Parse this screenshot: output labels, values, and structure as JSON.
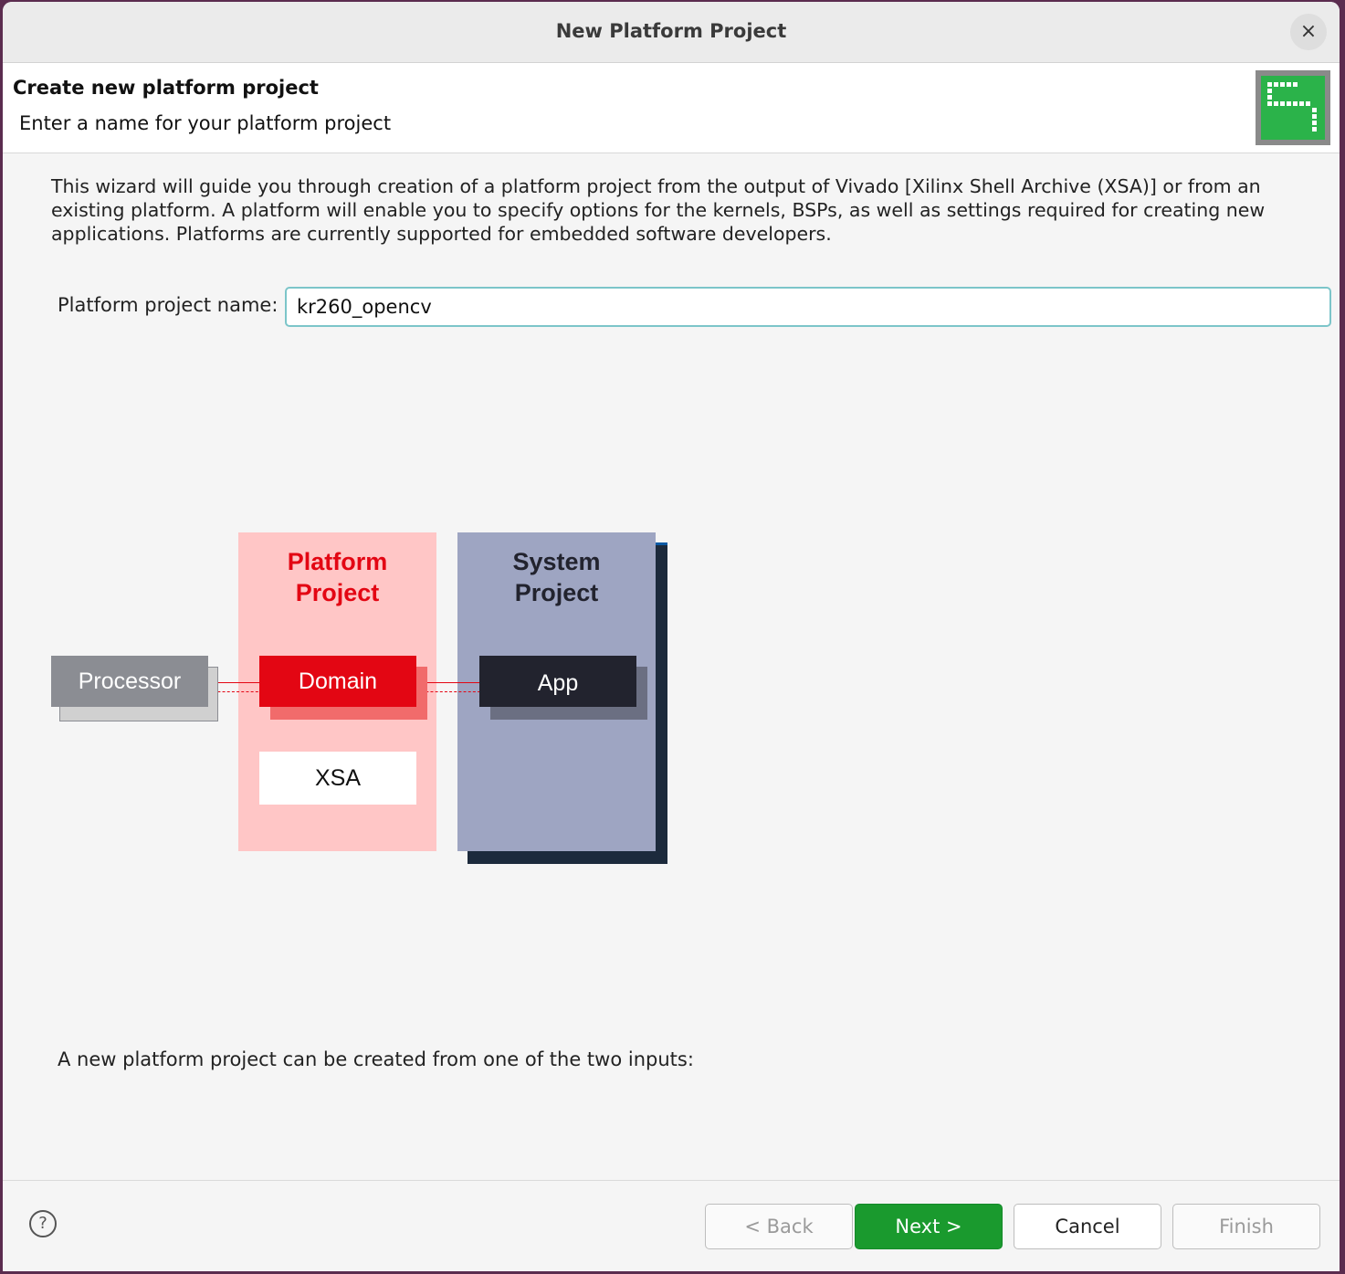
{
  "window": {
    "title": "New Platform Project",
    "close_glyph": "×"
  },
  "header": {
    "title": "Create new platform project",
    "subtitle": "Enter a name for your platform project",
    "logo_icon": "vitis-logo-icon"
  },
  "description": "This wizard will guide you through creation of a platform project from the output of Vivado [Xilinx Shell Archive (XSA)] or from an existing platform. A platform will enable you to specify options for the kernels, BSPs, as well as settings required for creating new applications. Platforms are currently supported for embedded software developers.",
  "form": {
    "name_label": "Platform project name:",
    "name_value": "kr260_opencv"
  },
  "diagram": {
    "processor": "Processor",
    "platform_title_1": "Platform",
    "platform_title_2": "Project",
    "domain": "Domain",
    "xsa": "XSA",
    "system_title_1": "System",
    "system_title_2": "Project",
    "app": "App",
    "colors": {
      "platform_bg": "#ffc6c6",
      "domain": "#e30613",
      "system_bg": "#9ea5c2",
      "app": "#22232e",
      "processor": "#8b8d93"
    }
  },
  "bottom_text": "A new platform project can be created from one of the two inputs:",
  "footer": {
    "help_glyph": "?",
    "back": "< Back",
    "next": "Next >",
    "cancel": "Cancel",
    "finish": "Finish"
  }
}
